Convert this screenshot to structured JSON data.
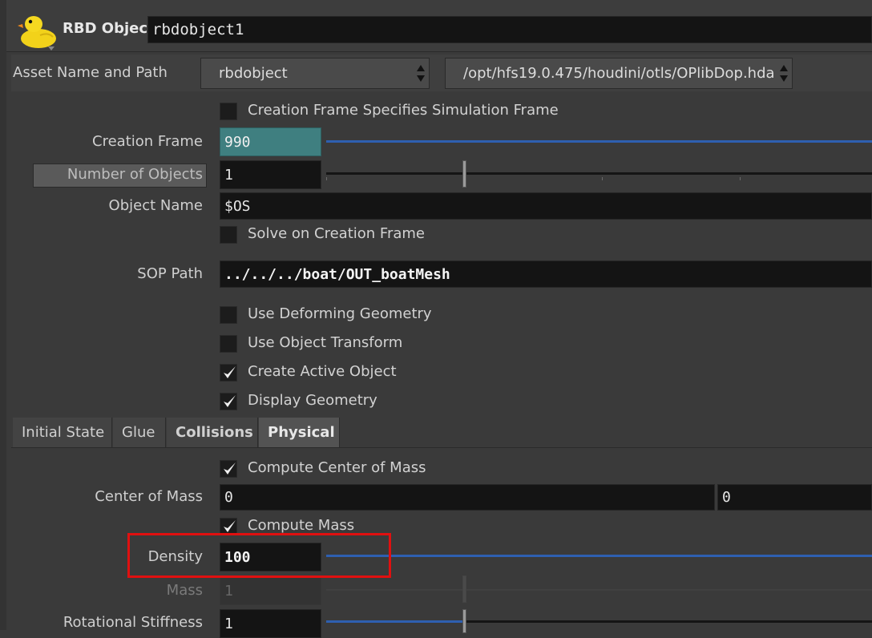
{
  "header": {
    "node_type_label": "RBD Object",
    "node_name": "rbdobject1",
    "logo_icon": "rubber-duck-icon"
  },
  "asset": {
    "label": "Asset Name and Path",
    "name": "rbdobject",
    "path": "/opt/hfs19.0.475/houdini/otls/OPlibDop.hda"
  },
  "params": {
    "creation_frame_specifies": {
      "label": "Creation Frame Specifies Simulation Frame",
      "checked": false
    },
    "creation_frame": {
      "label": "Creation Frame",
      "value": "990"
    },
    "num_objects": {
      "label": "Number of Objects",
      "value": "1",
      "slider_fraction": 0.25
    },
    "object_name": {
      "label": "Object Name",
      "value": "$OS"
    },
    "solve_on_creation": {
      "label": "Solve on Creation Frame",
      "checked": false
    },
    "sop_path": {
      "label": "SOP Path",
      "value": "../../../boat/OUT_boatMesh"
    },
    "use_deforming": {
      "label": "Use Deforming Geometry",
      "checked": false
    },
    "use_object_transform": {
      "label": "Use Object Transform",
      "checked": false
    },
    "create_active": {
      "label": "Create Active Object",
      "checked": true
    },
    "display_geometry": {
      "label": "Display Geometry",
      "checked": true
    }
  },
  "tabs": [
    {
      "label": "Initial State",
      "active": false,
      "bold": false
    },
    {
      "label": "Glue",
      "active": false,
      "bold": false
    },
    {
      "label": "Collisions",
      "active": false,
      "bold": true
    },
    {
      "label": "Physical",
      "active": true,
      "bold": true
    }
  ],
  "physical": {
    "compute_com": {
      "label": "Compute Center of Mass",
      "checked": true
    },
    "center_of_mass": {
      "label": "Center of Mass",
      "x": "0",
      "y": "0"
    },
    "compute_mass": {
      "label": "Compute Mass",
      "checked": true
    },
    "density": {
      "label": "Density",
      "value": "100"
    },
    "mass": {
      "label": "Mass",
      "value": "1",
      "disabled": true
    },
    "rotational_stiffness": {
      "label": "Rotational Stiffness",
      "value": "1",
      "slider_fraction": 0.25
    }
  },
  "colors": {
    "highlight_box": "#e01010",
    "creation_frame_bg": "#3f7f80",
    "slider_blue": "#2e5fb0"
  }
}
